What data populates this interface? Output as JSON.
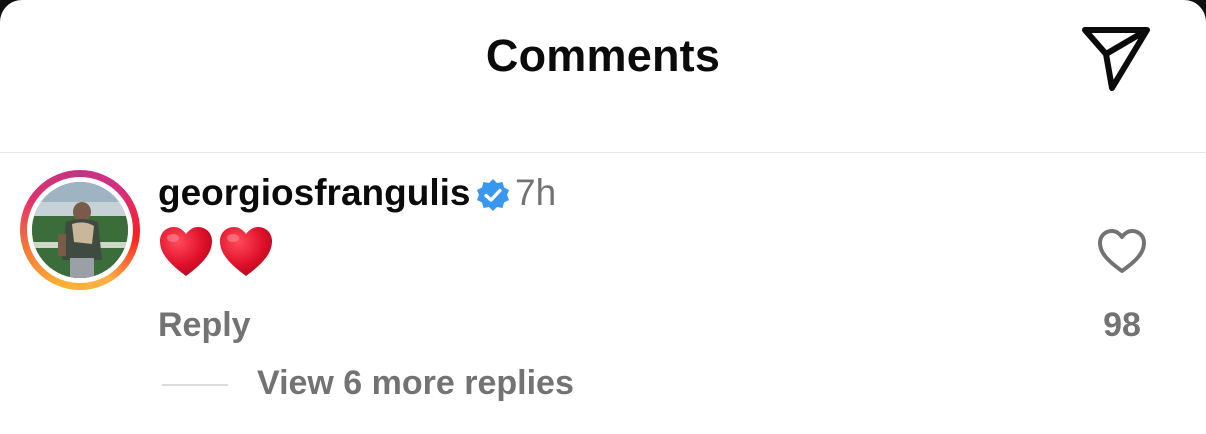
{
  "header": {
    "title": "Comments",
    "share_icon": "paper-plane-icon"
  },
  "comment": {
    "avatar_icon": "user-avatar-story-ring",
    "username": "georgiosfrangulis",
    "verified_icon": "verified-badge-icon",
    "verified_color": "#3897f0",
    "timestamp": "7h",
    "text": "❤️❤️",
    "reply_label": "Reply",
    "like_icon": "heart-outline-icon",
    "like_count": "98",
    "view_replies_label": "View 6 more replies"
  },
  "colors": {
    "primary_text": "#0b0b0b",
    "secondary_text": "#737373",
    "heart_red": "#e0102a",
    "story_ring": [
      "#fbb034",
      "#f77737",
      "#e1306c",
      "#c13584"
    ]
  }
}
